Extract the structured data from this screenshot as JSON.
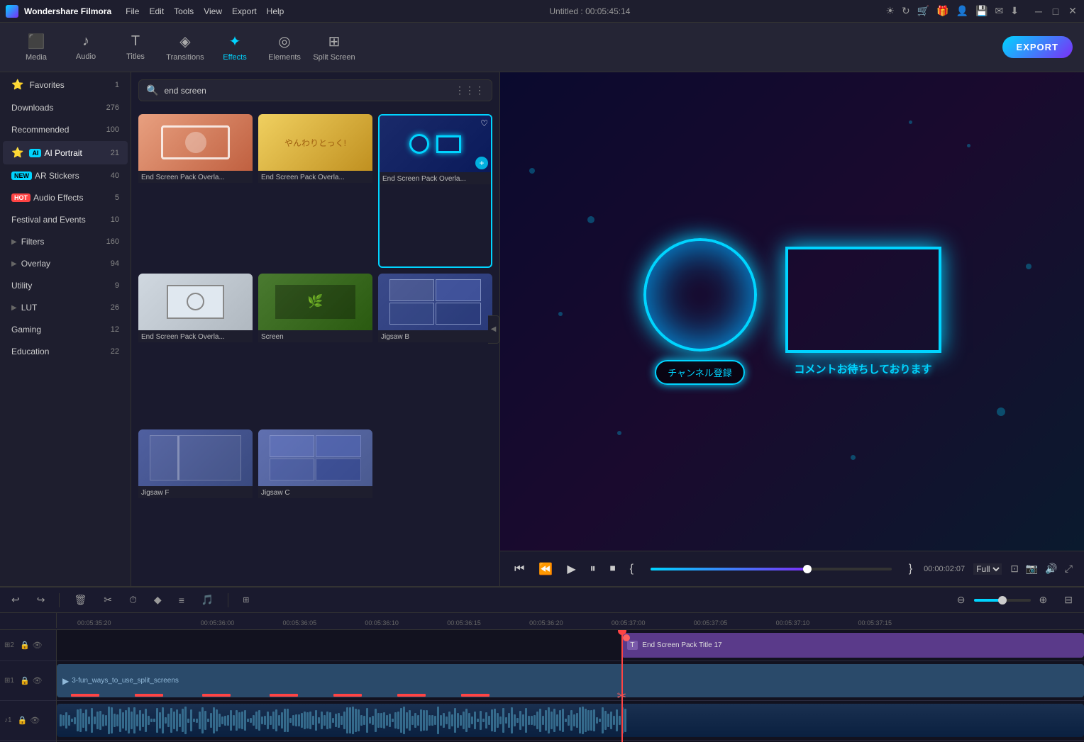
{
  "app": {
    "name": "Wondershare Filmora",
    "title": "Untitled : 00:05:45:14"
  },
  "menu": {
    "items": [
      "File",
      "Edit",
      "Tools",
      "View",
      "Export",
      "Help"
    ]
  },
  "header_icons": [
    "sun",
    "refresh",
    "cart",
    "gift",
    "user",
    "save",
    "mail",
    "download"
  ],
  "window_controls": [
    "minimize",
    "maximize",
    "close"
  ],
  "toolbar": {
    "items": [
      {
        "id": "media",
        "label": "Media",
        "icon": "⬛"
      },
      {
        "id": "audio",
        "label": "Audio",
        "icon": "🎵"
      },
      {
        "id": "titles",
        "label": "Titles",
        "icon": "T"
      },
      {
        "id": "transitions",
        "label": "Transitions",
        "icon": "◈"
      },
      {
        "id": "effects",
        "label": "Effects",
        "icon": "✦"
      },
      {
        "id": "elements",
        "label": "Elements",
        "icon": "◎"
      },
      {
        "id": "split_screen",
        "label": "Split Screen",
        "icon": "⊞"
      }
    ],
    "active": "effects",
    "export_label": "EXPORT"
  },
  "sidebar": {
    "items": [
      {
        "id": "favorites",
        "label": "Favorites",
        "count": "1",
        "icon": "⭐",
        "badge": null,
        "has_expand": false
      },
      {
        "id": "downloads",
        "label": "Downloads",
        "count": "276",
        "icon": null,
        "badge": null,
        "has_expand": false
      },
      {
        "id": "recommended",
        "label": "Recommended",
        "count": "100",
        "icon": null,
        "badge": null,
        "has_expand": false
      },
      {
        "id": "ai_portrait",
        "label": "AI Portrait",
        "count": "21",
        "icon": "⭐",
        "badge": "AI",
        "has_expand": false
      },
      {
        "id": "ar_stickers",
        "label": "AR Stickers",
        "count": "40",
        "icon": null,
        "badge": "NEW",
        "has_expand": false
      },
      {
        "id": "audio_effects",
        "label": "Audio Effects",
        "count": "5",
        "icon": null,
        "badge": "HOT",
        "has_expand": false
      },
      {
        "id": "festival_events",
        "label": "Festival and Events",
        "count": "10",
        "icon": null,
        "badge": null,
        "has_expand": false
      },
      {
        "id": "filters",
        "label": "Filters",
        "count": "160",
        "icon": null,
        "badge": null,
        "has_expand": true
      },
      {
        "id": "overlay",
        "label": "Overlay",
        "count": "94",
        "icon": null,
        "badge": null,
        "has_expand": true
      },
      {
        "id": "utility",
        "label": "Utility",
        "count": "9",
        "icon": null,
        "badge": null,
        "has_expand": false
      },
      {
        "id": "lut",
        "label": "LUT",
        "count": "26",
        "icon": null,
        "badge": null,
        "has_expand": true
      },
      {
        "id": "gaming",
        "label": "Gaming",
        "count": "12",
        "icon": null,
        "badge": null,
        "has_expand": false
      },
      {
        "id": "education",
        "label": "Education",
        "count": "22",
        "icon": null,
        "badge": null,
        "has_expand": false
      }
    ]
  },
  "search": {
    "placeholder": "end screen",
    "value": "end screen"
  },
  "effects": {
    "cards": [
      {
        "id": "card1",
        "label": "End Screen Pack Overla...",
        "selected": false,
        "color": "#e8a080",
        "type": "pink"
      },
      {
        "id": "card2",
        "label": "End Screen Pack Overla...",
        "selected": false,
        "color": "#f0c860",
        "type": "yellow"
      },
      {
        "id": "card3",
        "label": "End Screen Pack Overla...",
        "selected": true,
        "color": "#2a4a8a",
        "type": "blue"
      },
      {
        "id": "card4",
        "label": "End Screen Pack Overla...",
        "selected": false,
        "color": "#c8d0d8",
        "type": "gray"
      },
      {
        "id": "card5",
        "label": "Screen",
        "selected": false,
        "color": "#6a9040",
        "type": "green"
      },
      {
        "id": "card6",
        "label": "Jigsaw B",
        "selected": false,
        "color": "#5060a0",
        "type": "purple"
      },
      {
        "id": "card7",
        "label": "Jigsaw F",
        "selected": false,
        "color": "#7080b0",
        "type": "mixed"
      },
      {
        "id": "card8",
        "label": "Jigsaw C",
        "selected": false,
        "color": "#8090c0",
        "type": "mixed2"
      }
    ]
  },
  "preview": {
    "subscribe_text": "チャンネル登録",
    "comment_text": "コメントお待ちしております"
  },
  "playback": {
    "progress_pct": 65,
    "time_current": "00:00:02:07",
    "quality": "Full",
    "markers": {
      "left": "{",
      "right": "}"
    }
  },
  "timeline": {
    "ruler_marks": [
      "00:05:35:20",
      "00:05:36:00",
      "00:05:36:05",
      "00:05:36:10",
      "00:05:36:15",
      "00:05:36:20",
      "00:05:37:00",
      "00:05:37:05",
      "00:05:37:10",
      "00:05:37:15"
    ],
    "tracks": [
      {
        "id": "track1",
        "label": "T",
        "lock": true,
        "eye": true,
        "clip_label": "End Screen Pack Title 17"
      },
      {
        "id": "track2",
        "label": "▶",
        "lock": true,
        "eye": true,
        "clip_label": "3-fun_ways_to_use_split_screens"
      },
      {
        "id": "track3",
        "label": "♪",
        "lock": true,
        "eye": true,
        "clip_label": ""
      }
    ],
    "toolbar_buttons": [
      "undo",
      "redo",
      "delete",
      "cut",
      "duration",
      "diamond",
      "adjust",
      "audio"
    ],
    "playhead_position": "55%"
  }
}
